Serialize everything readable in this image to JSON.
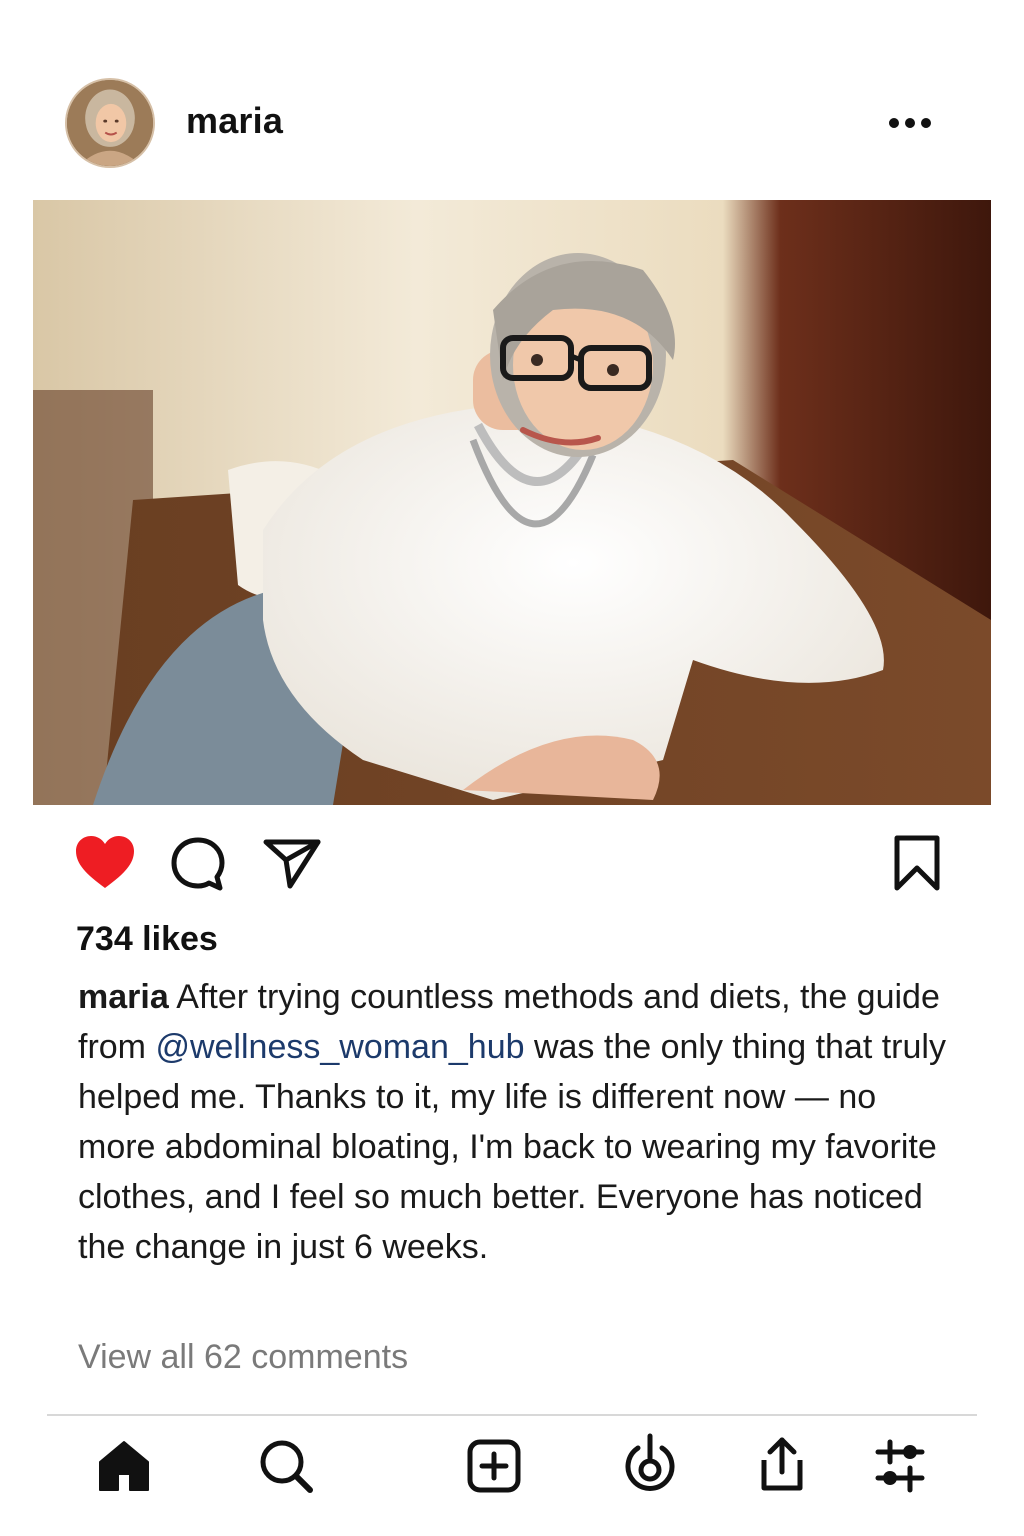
{
  "post": {
    "username": "maria",
    "likes_text": "734 likes",
    "caption": {
      "username": "maria",
      "text_before": " After trying countless methods and diets, the guide from ",
      "mention": "@wellness_woman_hub",
      "text_after": " was the only thing that truly helped me. Thanks to it, my life is different now — no more abdominal bloating, I'm back to wearing my favorite clothes, and I feel so much better. Everyone has noticed the change in just 6 weeks."
    },
    "comments_link": "View all 62 comments",
    "liked": true
  },
  "colors": {
    "like_red": "#ee1d23",
    "mention_blue": "#1c3a6b",
    "muted_gray": "#7a7a7a"
  },
  "icons": {
    "more": "more-horizontal-icon",
    "like": "heart-filled-icon",
    "comment": "comment-bubble-icon",
    "share": "send-paper-plane-icon",
    "save": "bookmark-icon",
    "nav": [
      "home-icon",
      "search-icon",
      "add-post-icon",
      "reels-icon",
      "share-upload-icon",
      "settings-sliders-icon"
    ]
  }
}
